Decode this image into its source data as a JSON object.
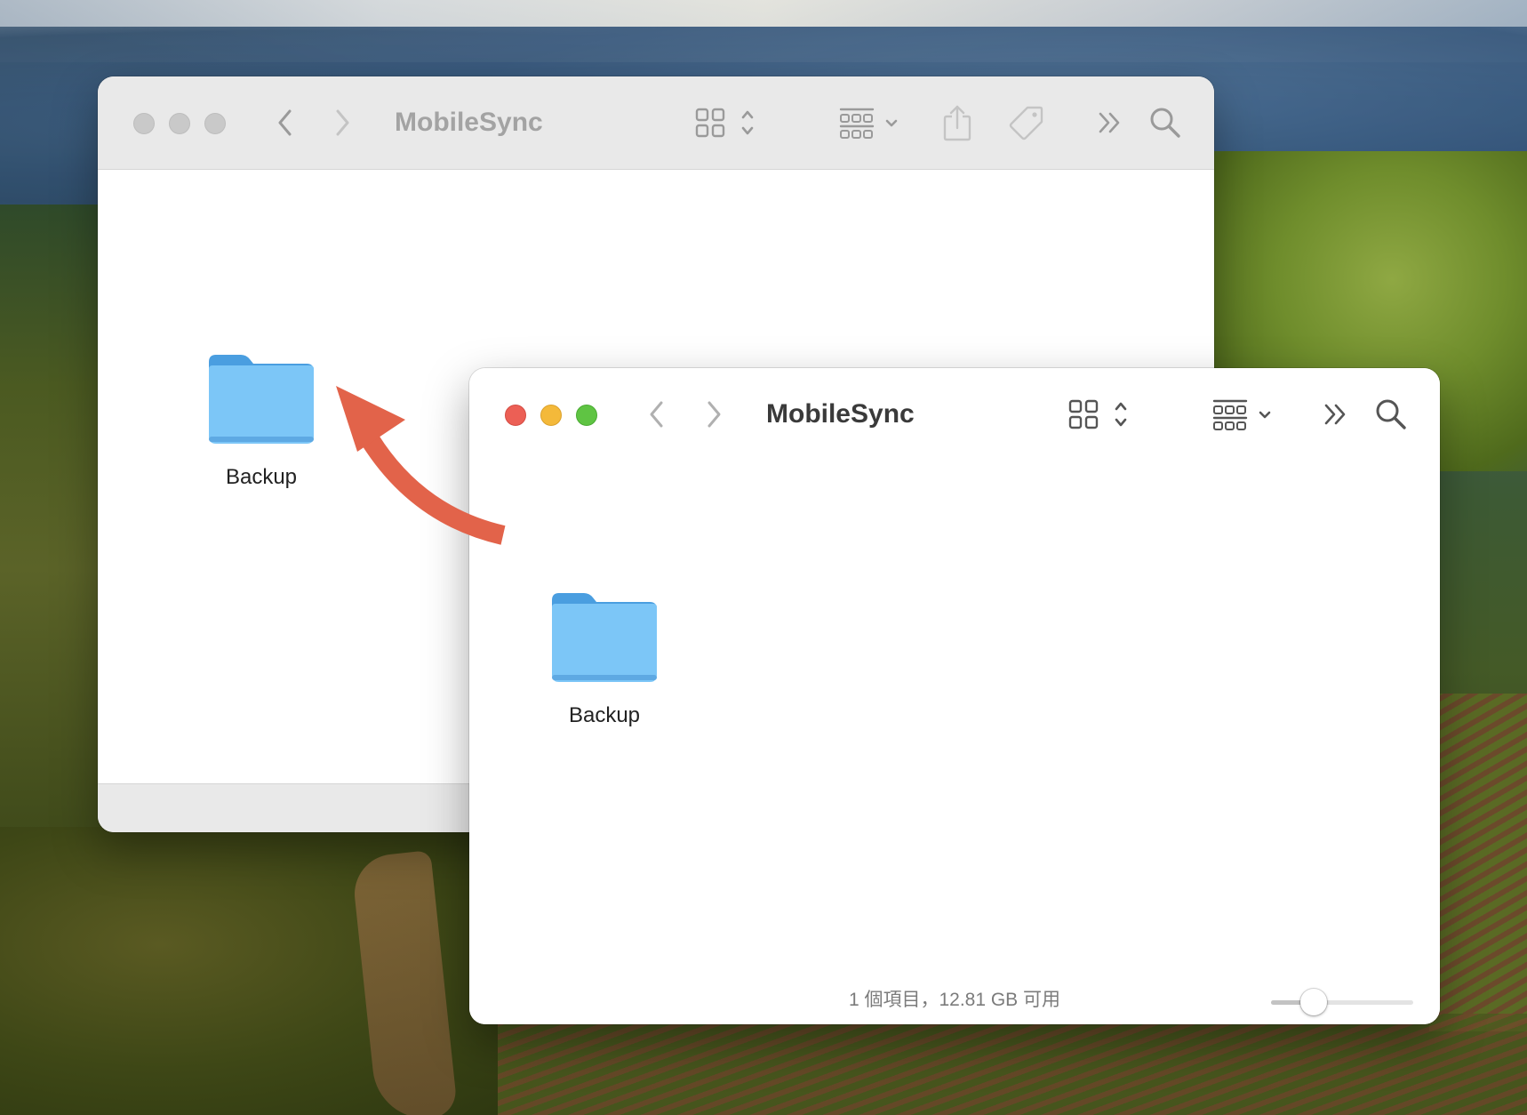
{
  "back_window": {
    "title": "MobileSync",
    "folder": {
      "label": "Backup"
    }
  },
  "front_window": {
    "title": "MobileSync",
    "folder": {
      "label": "Backup"
    },
    "status": "1 個項目，12.81 GB 可用",
    "icon_size_slider": 0.25
  },
  "icons": [
    "back-chevron-icon",
    "forward-chevron-icon",
    "icon-view-icon",
    "group-by-icon",
    "share-icon",
    "tag-icon",
    "more-toolbar-icon",
    "search-icon",
    "folder-icon"
  ],
  "colors": {
    "accent_arrow": "#e2634a",
    "folder_blue": "#7cc2f5",
    "close_red": "#ec5f55",
    "minimize_yellow": "#f4b93a",
    "zoom_green": "#5fc443"
  }
}
